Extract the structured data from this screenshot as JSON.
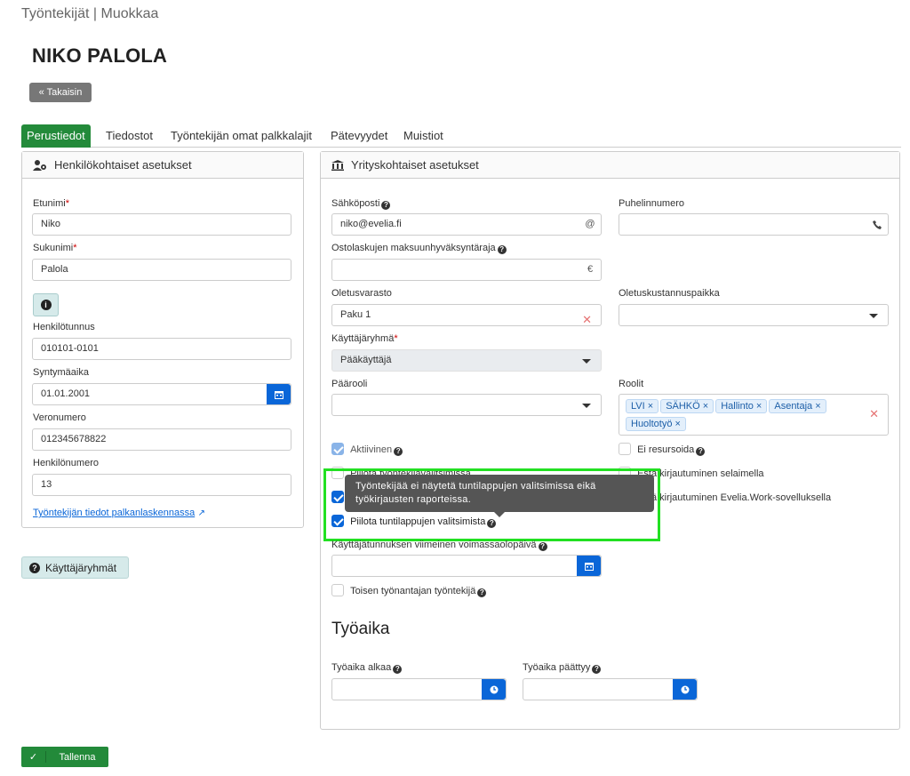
{
  "header": {
    "breadcrumb": "Työntekijät | Muokkaa",
    "title": "NIKO PALOLA",
    "back_label": "« Takaisin"
  },
  "tabs": [
    {
      "label": "Perustiedot",
      "active": true
    },
    {
      "label": "Tiedostot"
    },
    {
      "label": "Työntekijän omat palkkalajit"
    },
    {
      "label": "Pätevyydet"
    },
    {
      "label": "Muistiot"
    }
  ],
  "personal": {
    "heading": "Henkilökohtaiset asetukset",
    "first_name_label": "Etunimi",
    "first_name": "Niko",
    "last_name_label": "Sukunimi",
    "last_name": "Palola",
    "ssn_label": "Henkilötunnus",
    "ssn": "010101-0101",
    "birth_label": "Syntymäaika",
    "birth": "01.01.2001",
    "tax_label": "Veronumero",
    "tax": "012345678822",
    "person_no_label": "Henkilönumero",
    "person_no": "13",
    "payroll_link": "Työntekijän tiedot palkanlaskennassa"
  },
  "company": {
    "heading": "Yrityskohtaiset asetukset",
    "email_label": "Sähköposti",
    "email": "niko@evelia.fi",
    "phone_label": "Puhelinnumero",
    "phone": "",
    "approval_label": "Ostolaskujen maksuunhyväksyntäraja",
    "approval": "",
    "warehouse_label": "Oletusvarasto",
    "warehouse": "Paku 1",
    "cost_center_label": "Oletuskustannuspaikka",
    "user_group_label": "Käyttäjäryhmä",
    "user_group": "Pääkäyttäjä",
    "main_role_label": "Päärooli",
    "roles_label": "Roolit",
    "roles": [
      "LVI ×",
      "SÄHKÖ ×",
      "Hallinto ×",
      "Asentaja ×",
      "Huoltotyö ×"
    ],
    "active_label": "Aktiivinen",
    "no_resource_label": "Ei resursoida",
    "hide_employee_selector_label": "Piilota työntekijävalitsimissa",
    "prevent_browser_label": "Estä kirjautuminen selaimella",
    "prevent_app_label": "Estä kirjautuminen Evelia.Work-sovelluksella",
    "hide_timesheet_label": "Piilota tuntilappujen valitsimista",
    "account_expiry_label": "Käyttäjätunnuksen viimeinen voimassaolopäivä",
    "other_employer_label": "Toisen työnantajan työntekijä",
    "worktime_title": "Työaika",
    "worktime_start_label": "Työaika alkaa",
    "worktime_end_label": "Työaika päättyy"
  },
  "tooltip": "Työntekijää ei näytetä tuntilappujen valitsimissa eikä työkirjausten raporteissa.",
  "buttons": {
    "user_groups": "Käyttäjäryhmät",
    "save": "Tallenna"
  },
  "colors": {
    "accent_green": "#238a3a",
    "accent_blue": "#0a66d8",
    "highlight": "#22e022"
  }
}
